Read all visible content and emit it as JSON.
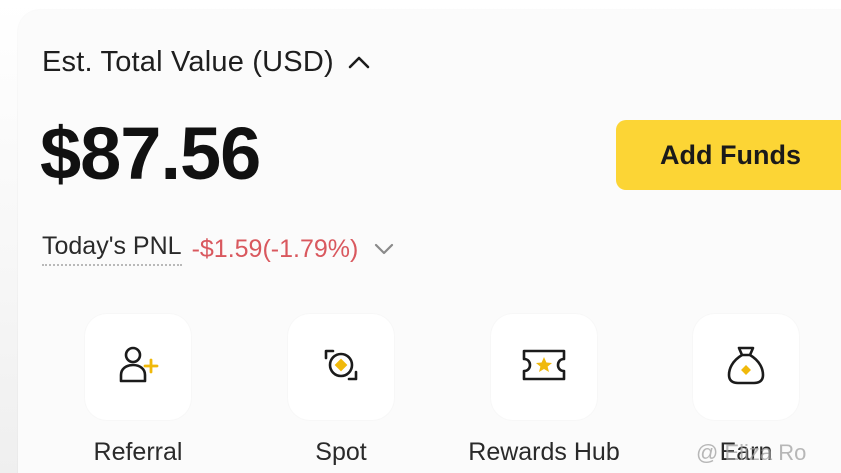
{
  "header": {
    "est_label": "Est. Total Value (USD)",
    "balance": "$87.56",
    "add_funds_label": "Add Funds"
  },
  "pnl": {
    "label": "Today's PNL",
    "value": "-$1.59(-1.79%)"
  },
  "shortcuts": [
    {
      "label": "Referral",
      "icon": "add-user-icon"
    },
    {
      "label": "Spot",
      "icon": "spot-exchange-icon"
    },
    {
      "label": "Rewards Hub",
      "icon": "ticket-star-icon"
    },
    {
      "label": "Earn",
      "icon": "money-bag-icon"
    }
  ],
  "watermark": "@ Eliza Ro",
  "colors": {
    "accent": "#fcd535",
    "negative": "#d9585e",
    "text": "#1b1b1b"
  }
}
